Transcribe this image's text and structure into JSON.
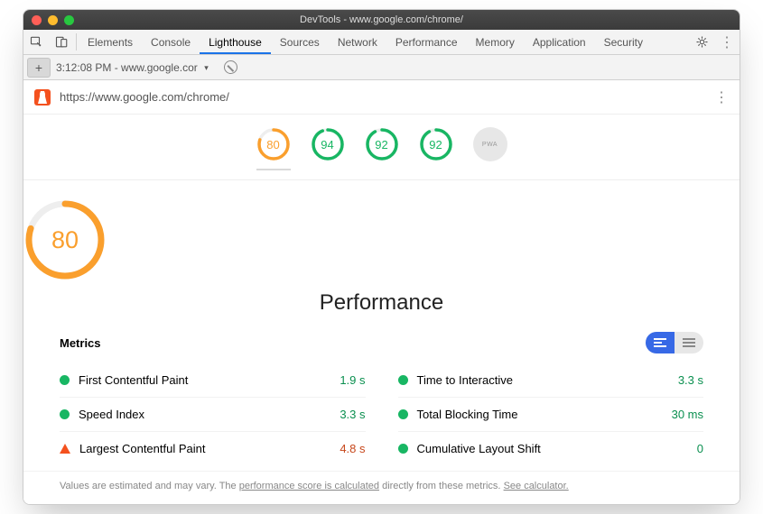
{
  "window": {
    "title": "DevTools - www.google.com/chrome/"
  },
  "tabs": {
    "items": [
      "Elements",
      "Console",
      "Lighthouse",
      "Sources",
      "Network",
      "Performance",
      "Memory",
      "Application",
      "Security"
    ],
    "active_index": 2
  },
  "toolbar2": {
    "timestamp": "3:12:08 PM - www.google.cor"
  },
  "url": "https://www.google.com/chrome/",
  "gauges": [
    {
      "score": 80,
      "color": "orange"
    },
    {
      "score": 94,
      "color": "green"
    },
    {
      "score": 92,
      "color": "green"
    },
    {
      "score": 92,
      "color": "green"
    }
  ],
  "pwa_label": "PWA",
  "big_gauge": {
    "score": 80,
    "color": "orange"
  },
  "category_title": "Performance",
  "metrics_heading": "Metrics",
  "metrics": [
    {
      "name": "First Contentful Paint",
      "value": "1.9 s",
      "status": "green",
      "shape": "circle"
    },
    {
      "name": "Time to Interactive",
      "value": "3.3 s",
      "status": "green",
      "shape": "circle"
    },
    {
      "name": "Speed Index",
      "value": "3.3 s",
      "status": "green",
      "shape": "circle"
    },
    {
      "name": "Total Blocking Time",
      "value": "30 ms",
      "status": "green",
      "shape": "circle"
    },
    {
      "name": "Largest Contentful Paint",
      "value": "4.8 s",
      "status": "orange",
      "shape": "triangle"
    },
    {
      "name": "Cumulative Layout Shift",
      "value": "0",
      "status": "green",
      "shape": "circle"
    }
  ],
  "footnote": {
    "pre": "Values are estimated and may vary. The ",
    "link1": "performance score is calculated",
    "mid": " directly from these metrics. ",
    "link2": "See calculator."
  }
}
